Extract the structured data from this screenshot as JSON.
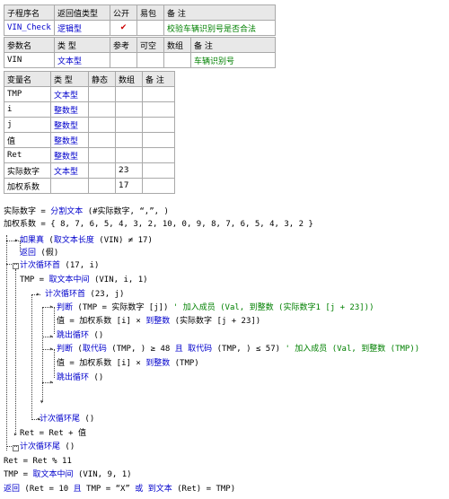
{
  "sub_table": {
    "headers": [
      "子程序名",
      "返回值类型",
      "公开",
      "易包",
      "备 注"
    ],
    "row": {
      "name": "VIN_Check",
      "type": "逻辑型",
      "public": "✔",
      "easy": "",
      "note": "校验车辆识别号是否合法"
    }
  },
  "param_table": {
    "headers": [
      "参数名",
      "类 型",
      "参考",
      "可空",
      "数组",
      "备 注"
    ],
    "row": {
      "name": "VIN",
      "type": "文本型",
      "ref": "",
      "nullable": "",
      "array": "",
      "note": "车辆识别号"
    }
  },
  "var_table": {
    "headers": [
      "变量名",
      "类 型",
      "静态",
      "数组",
      "备 注"
    ],
    "rows": [
      {
        "name": "TMP",
        "type": "文本型",
        "static": "",
        "array": "",
        "note": ""
      },
      {
        "name": "i",
        "type": "整数型",
        "static": "",
        "array": "",
        "note": ""
      },
      {
        "name": "j",
        "type": "整数型",
        "static": "",
        "array": "",
        "note": ""
      },
      {
        "name": "值",
        "type": "整数型",
        "static": "",
        "array": "",
        "note": ""
      },
      {
        "name": "Ret",
        "type": "整数型",
        "static": "",
        "array": "",
        "note": ""
      },
      {
        "name": "实际数字",
        "type": "文本型",
        "static": "",
        "array": "23",
        "note": ""
      },
      {
        "name": "加权系数",
        "type": "",
        "static": "",
        "array": "17",
        "note": ""
      }
    ]
  },
  "code": {
    "l1a": "实际数字 = ",
    "l1b": "分割文本",
    "l1c": " (#实际数字, “,”, )",
    "l2": "加权系数 = { 8, 7, 6, 5, 4, 3, 2, 10, 0, 9, 8, 7, 6, 5, 4, 3, 2 }",
    "l3a": "如果真",
    "l3b": " (",
    "l3c": "取文本长度",
    "l3d": " (VIN) ≠ 17)",
    "l4a": "返回",
    "l4b": " (假)",
    "l5a": "计次循环首",
    "l5b": " (17, i)",
    "l6a": "TMP = ",
    "l6b": "取文本中间",
    "l6c": " (VIN, i, 1)",
    "l7a": "计次循环首",
    "l7b": " (23, j)",
    "l8a": "判断",
    "l8b": " (TMP = 实际数字 [j]) ",
    "l8c": "' 加入成员 (Val, 到整数 (实际数字1 [j + 23]))",
    "l9a": "值 = 加权系数 [i] × ",
    "l9b": "到整数",
    "l9c": " (实际数字 [j + 23])",
    "l10a": "跳出循环",
    "l10b": " ()",
    "l11a": "判断",
    "l11b": " (",
    "l11c": "取代码",
    "l11d": " (TMP, ) ≥ 48 ",
    "l11e": "且",
    "l11f": " ",
    "l11g": "取代码",
    "l11h": " (TMP, ) ≤ 57) ",
    "l11i": "' 加入成员 (Val, 到整数 (TMP))",
    "l12a": "值 = 加权系数 [i] × ",
    "l12b": "到整数",
    "l12c": " (TMP)",
    "l13a": "跳出循环",
    "l13b": " ()",
    "l14a": "计次循环尾",
    "l14b": " ()",
    "l15": "Ret = Ret + 值",
    "l16a": "计次循环尾",
    "l16b": " ()",
    "l17": "Ret = Ret % 11",
    "l18a": "TMP = ",
    "l18b": "取文本中间",
    "l18c": " (VIN, 9, 1)",
    "l19a": "返回",
    "l19b": " (Ret = 10 ",
    "l19c": "且",
    "l19d": " TMP = “X” ",
    "l19e": "或",
    "l19f": " ",
    "l19g": "到文本",
    "l19h": " (Ret) = TMP)"
  }
}
